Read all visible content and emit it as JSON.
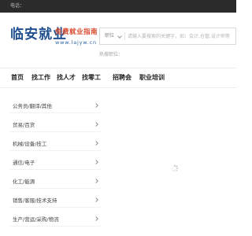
{
  "topbar": {
    "phone_label": "电话："
  },
  "logo": {
    "title": "临安就业",
    "slogan": "免费就业指南",
    "url": "www.lajyw.cn"
  },
  "search": {
    "select_label": "职位",
    "placeholder": "请输入要搜索的关键字，如：会计,仓管,设计师等",
    "hot_label": "热搜职位："
  },
  "nav": {
    "items": [
      {
        "label": "首页"
      },
      {
        "label": "找工作"
      },
      {
        "label": "找人才"
      },
      {
        "label": "找零工"
      },
      {
        "label": "招聘会"
      },
      {
        "label": "职业培训"
      }
    ]
  },
  "categories": [
    {
      "label": "公务员/翻译/其他"
    },
    {
      "label": "贸易/百货"
    },
    {
      "label": "机械/设备/技工"
    },
    {
      "label": "通信/电子"
    },
    {
      "label": "化工/能源"
    },
    {
      "label": "销售/客服/技术支持"
    },
    {
      "label": "生产/营运/采购/物流"
    }
  ]
}
